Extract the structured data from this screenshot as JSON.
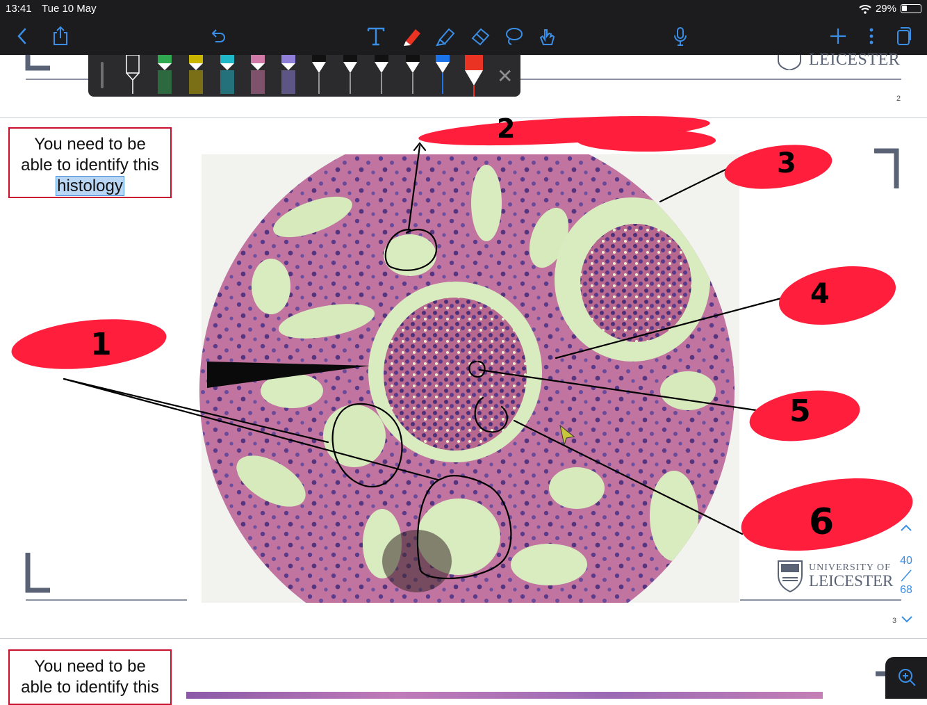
{
  "status_bar": {
    "time": "13:41",
    "date": "Tue 10 May",
    "battery": "29%"
  },
  "toolbar": {
    "back_icon": "chevron-left-icon",
    "share_icon": "share-icon",
    "undo_icon": "undo-icon",
    "text_tool_icon": "text-tool-icon",
    "pen_tool_icon": "pen-icon",
    "highlighter_icon": "highlighter-icon",
    "eraser_icon": "eraser-icon",
    "lasso_icon": "lasso-icon",
    "hand_icon": "hand-touch-icon",
    "mic_icon": "microphone-icon",
    "add_icon": "plus-icon",
    "more_icon": "more-vertical-icon",
    "pages_icon": "pages-icon",
    "accent": "#3a8ee6"
  },
  "pen_palette": {
    "pens": [
      {
        "color": "#ffffff",
        "kind": "pencil"
      },
      {
        "color": "#2fa84f",
        "kind": "highlighter"
      },
      {
        "color": "#c9b400",
        "kind": "highlighter"
      },
      {
        "color": "#1fb8c9",
        "kind": "highlighter"
      },
      {
        "color": "#d17aa8",
        "kind": "highlighter"
      },
      {
        "color": "#8f7fd9",
        "kind": "highlighter"
      },
      {
        "color": "#111111",
        "kind": "pen"
      },
      {
        "color": "#111111",
        "kind": "pen"
      },
      {
        "color": "#111111",
        "kind": "pen"
      },
      {
        "color": "#111111",
        "kind": "pen"
      },
      {
        "color": "#1a73e8",
        "kind": "pen"
      },
      {
        "color": "#ea3323",
        "kind": "pen",
        "selected": true
      }
    ],
    "close_icon": "close-icon"
  },
  "document": {
    "upper_page_number": "2",
    "lower_page_number": "3",
    "callout_line1": "You need to be",
    "callout_line2": "able to identify this",
    "callout_highlight": "histology",
    "callout2_line1": "You need to be",
    "callout2_line2": "able to identify this",
    "logo_line1": "UNIVERSITY OF",
    "logo_line2": "LEICESTER",
    "logo_top_partial": "LEICESTER"
  },
  "annotations": {
    "labels": [
      "1",
      "2",
      "3",
      "4",
      "5",
      "6"
    ],
    "scribble_color": "#ff1f3d"
  },
  "page_nav": {
    "current": "40",
    "total": "68",
    "up_icon": "chevron-up-icon",
    "down_icon": "chevron-down-icon",
    "zoom_icon": "zoom-in-icon"
  }
}
